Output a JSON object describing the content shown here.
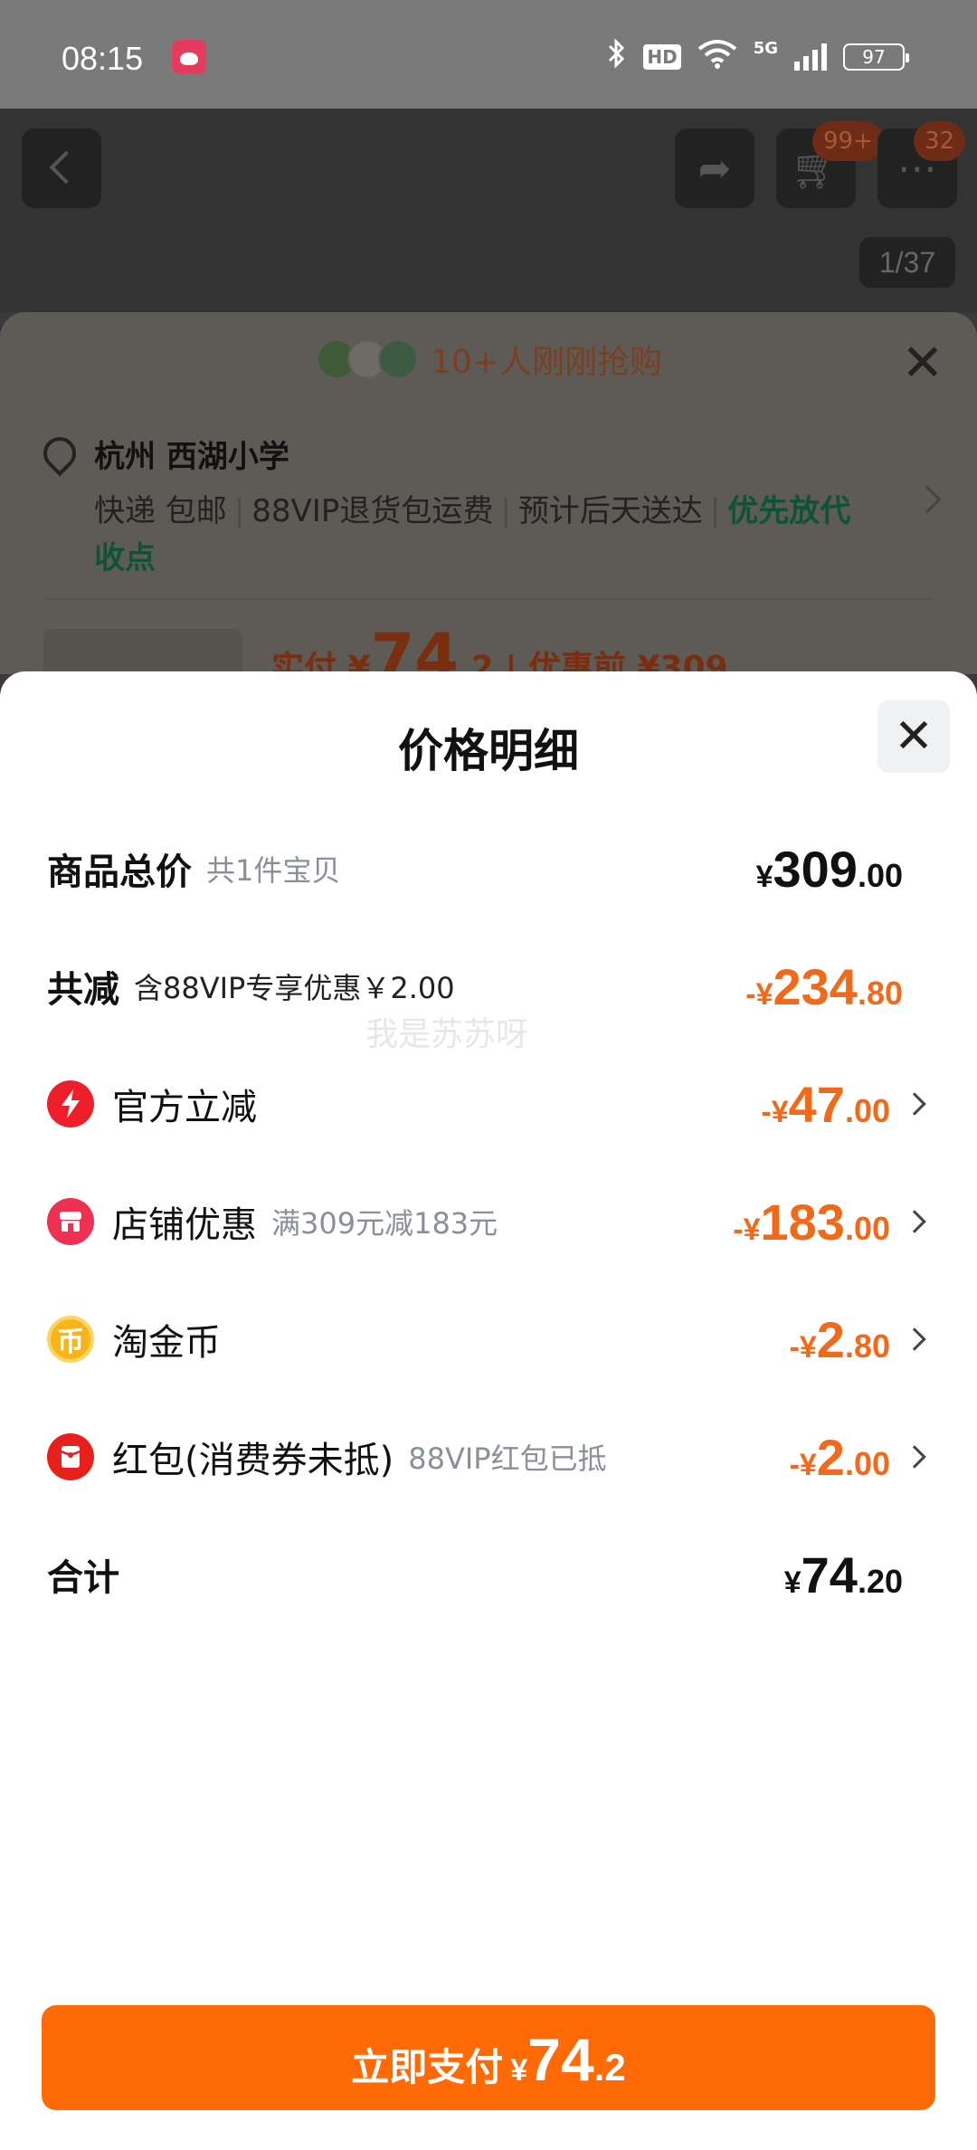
{
  "status_bar": {
    "time": "08:15",
    "icons": [
      "bluetooth-icon",
      "hd-icon",
      "wifi-icon",
      "signal-icon"
    ],
    "hd": "HD",
    "network": "5G",
    "battery": "97"
  },
  "header": {
    "cart_badge": "99+",
    "more_badge": "32",
    "image_counter": "1/37"
  },
  "order_sheet": {
    "buyers_text": "10+人刚刚抢购",
    "location": "杭州 西湖小学",
    "delivery": {
      "shipping": "快递 包邮",
      "return": "88VIP退货包运费",
      "eta": "预计后天送达",
      "option": "优先放代收点"
    },
    "pay_peek": {
      "label": "实付 ¥",
      "int": "74",
      "dec": ".2",
      "before": "| 优惠前 ¥309"
    }
  },
  "modal": {
    "title": "价格明细",
    "watermark": "我是苏苏呀",
    "rows": [
      {
        "label": "商品总价",
        "sub": "共1件宝贝",
        "currency": "¥",
        "int": "309",
        "dec": ".00"
      },
      {
        "label": "共减",
        "sub": "含88VIP专享优惠￥2.00",
        "currency": "-¥",
        "int": "234",
        "dec": ".80"
      },
      {
        "label": "官方立减",
        "sub": "",
        "currency": "-¥",
        "int": "47",
        "dec": ".00",
        "icon": "lightning-icon"
      },
      {
        "label": "店铺优惠",
        "sub": "满309元减183元",
        "currency": "-¥",
        "int": "183",
        "dec": ".00",
        "icon": "shop-icon"
      },
      {
        "label": "淘金币",
        "sub": "",
        "currency": "-¥",
        "int": "2",
        "dec": ".80",
        "icon": "coin-icon",
        "icon_glyph": "币"
      },
      {
        "label": "红包(消费券未抵)",
        "sub": "88VIP红包已抵",
        "currency": "-¥",
        "int": "2",
        "dec": ".00",
        "icon": "red-packet-icon"
      },
      {
        "label": "合计",
        "sub": "",
        "currency": "¥",
        "int": "74",
        "dec": ".20"
      }
    ],
    "pay_button": {
      "label": "立即支付",
      "currency": "¥",
      "int": "74",
      "dec": ".2"
    }
  },
  "colors": {
    "accent_orange": "#ff6a07",
    "amount_orange": "#f2691a",
    "delivery_green": "#0d5338"
  }
}
